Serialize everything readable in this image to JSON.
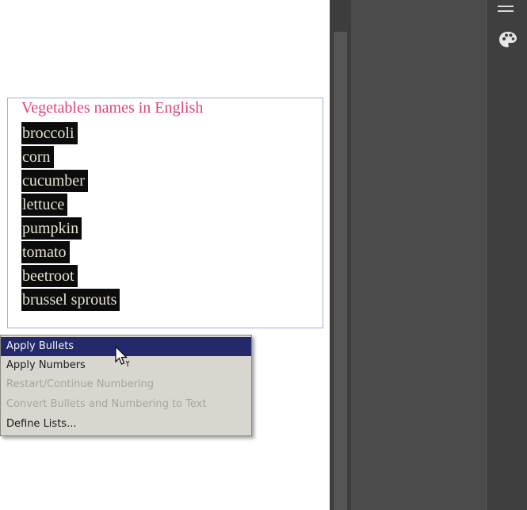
{
  "document": {
    "frame_title": "Vegetables names in English",
    "items": [
      "broccoli",
      "corn",
      "cucumber",
      "lettuce",
      "pumpkin",
      "tomato",
      "beetroot",
      "brussel sprouts"
    ]
  },
  "context_menu": {
    "items": [
      {
        "label": "Apply Bullets",
        "state": "highlighted"
      },
      {
        "label": "Apply Numbers",
        "state": "enabled"
      },
      {
        "label": "Restart/Continue Numbering",
        "state": "disabled"
      },
      {
        "label": "Convert Bullets and Numbering to Text",
        "state": "disabled"
      },
      {
        "label": "Define Lists...",
        "state": "enabled"
      }
    ]
  },
  "side_panel": {
    "icons": [
      "hamburger-menu-icon",
      "palette-icon"
    ]
  },
  "colors": {
    "title": "#e0437a",
    "selection": "#0c0c0c",
    "menu_highlight": "#23296b",
    "panel_bg": "#4b4b4b"
  }
}
